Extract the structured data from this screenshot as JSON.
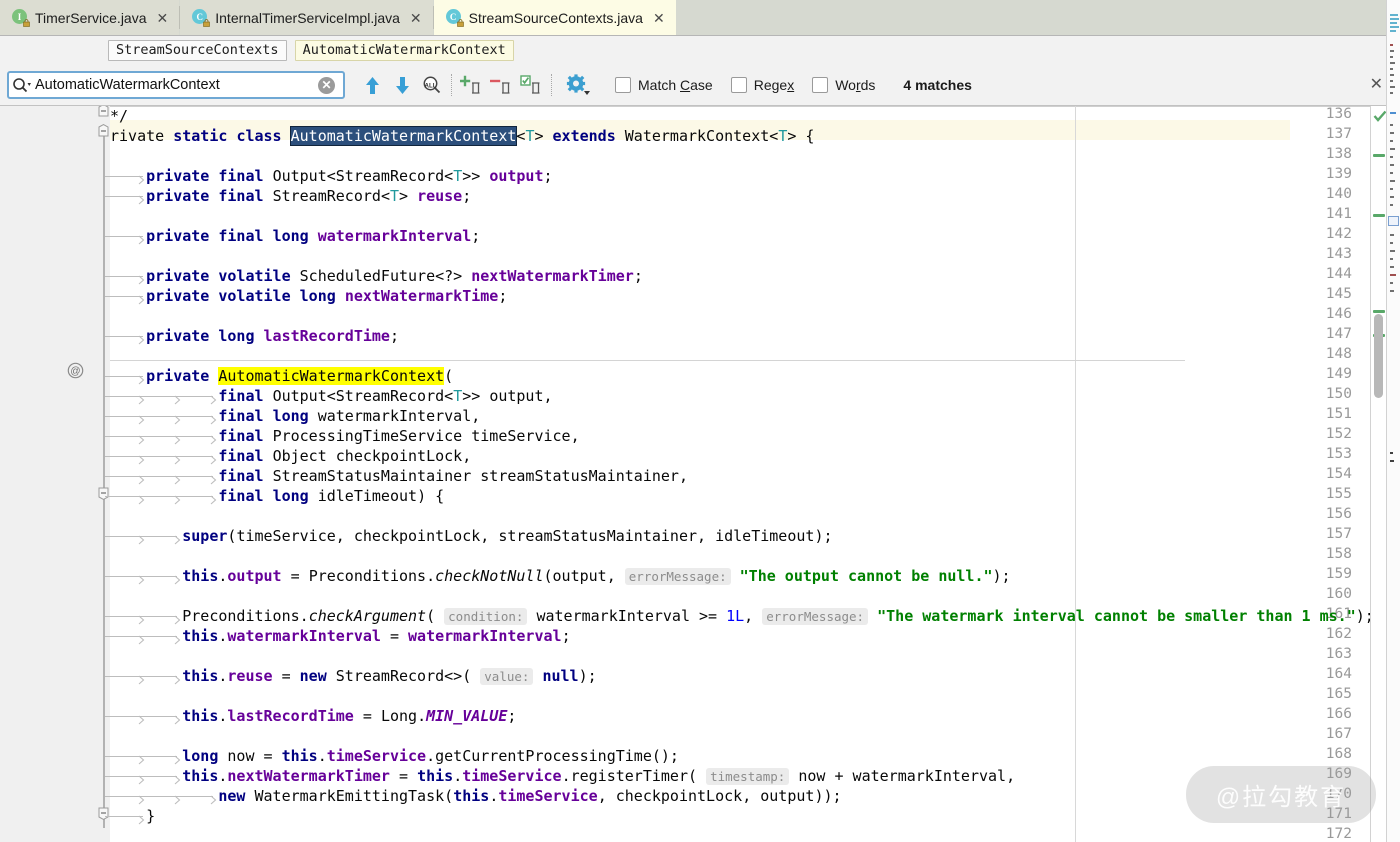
{
  "window": {
    "title": "StreamSourceContexts.java"
  },
  "tabs": [
    {
      "label": "TimerService.java",
      "icon": "interface-icon",
      "glyph": "I",
      "selected": false
    },
    {
      "label": "InternalTimerServiceImpl.java",
      "icon": "class-icon",
      "glyph": "C",
      "selected": false
    },
    {
      "label": "StreamSourceContexts.java",
      "icon": "class-icon",
      "glyph": "C",
      "selected": true
    }
  ],
  "tab_close_glyph": "✕",
  "breadcrumbs": [
    {
      "label": "StreamSourceContexts",
      "highlighted": false
    },
    {
      "label": "AutomaticWatermarkContext",
      "highlighted": true
    }
  ],
  "find": {
    "value": "AutomaticWatermarkContext",
    "placeholder": "Find",
    "clear_glyph": "✕",
    "buttons": [
      {
        "name": "find-previous-button",
        "tip": "Previous Occurrence"
      },
      {
        "name": "find-next-button",
        "tip": "Next Occurrence"
      },
      {
        "name": "select-all-occurrences-button",
        "tip": "Select All Occurrences"
      },
      {
        "name": "add-occurrence-button",
        "tip": "Add Occurrence"
      },
      {
        "name": "remove-occurrence-button",
        "tip": "Remove Occurrence"
      },
      {
        "name": "select-all-button",
        "tip": "Select All"
      },
      {
        "name": "find-settings-button",
        "tip": "Find Settings"
      }
    ],
    "options": [
      {
        "label_pre": "Match ",
        "label_mnemonic": "C",
        "label_post": "ase",
        "checked": false,
        "name": "match-case-checkbox"
      },
      {
        "label_pre": "Rege",
        "label_mnemonic": "x",
        "label_post": "",
        "checked": false,
        "name": "regex-checkbox"
      },
      {
        "label_pre": "Wo",
        "label_mnemonic": "r",
        "label_post": "ds",
        "checked": false,
        "name": "words-checkbox"
      }
    ],
    "status": "4 matches",
    "close_glyph": "✕"
  },
  "editor": {
    "first_line": 136,
    "last_line": 172,
    "annotation_line": 149,
    "annotation_glyph": "@",
    "caret_line": 137,
    "right_margin_col_x": 1075,
    "colors": {
      "keyword": "#000080",
      "field": "#660099",
      "string": "#008000",
      "number": "#0000ff",
      "generic": "#20999d",
      "hint_bg": "#ebebeb",
      "find_current": "#2c4f7c",
      "find_hit": "#ffff00",
      "caret_row": "#fcf9e7",
      "marker_green": "#59a869"
    },
    "lines": [
      {
        "n": 136,
        "text": "*/"
      },
      {
        "n": 137,
        "text": "rivate static class AutomaticWatermarkContext<T> extends WatermarkContext<T> {"
      },
      {
        "n": 138,
        "text": ""
      },
      {
        "n": 139,
        "text": "    private final Output<StreamRecord<T>> output;"
      },
      {
        "n": 140,
        "text": "    private final StreamRecord<T> reuse;"
      },
      {
        "n": 141,
        "text": ""
      },
      {
        "n": 142,
        "text": "    private final long watermarkInterval;"
      },
      {
        "n": 143,
        "text": ""
      },
      {
        "n": 144,
        "text": "    private volatile ScheduledFuture<?> nextWatermarkTimer;"
      },
      {
        "n": 145,
        "text": "    private volatile long nextWatermarkTime;"
      },
      {
        "n": 146,
        "text": ""
      },
      {
        "n": 147,
        "text": "    private long lastRecordTime;"
      },
      {
        "n": 148,
        "text": ""
      },
      {
        "n": 149,
        "text": "    private AutomaticWatermarkContext("
      },
      {
        "n": 150,
        "text": "            final Output<StreamRecord<T>> output,"
      },
      {
        "n": 151,
        "text": "            final long watermarkInterval,"
      },
      {
        "n": 152,
        "text": "            final ProcessingTimeService timeService,"
      },
      {
        "n": 153,
        "text": "            final Object checkpointLock,"
      },
      {
        "n": 154,
        "text": "            final StreamStatusMaintainer streamStatusMaintainer,"
      },
      {
        "n": 155,
        "text": "            final long idleTimeout) {"
      },
      {
        "n": 156,
        "text": ""
      },
      {
        "n": 157,
        "text": "        super(timeService, checkpointLock, streamStatusMaintainer, idleTimeout);"
      },
      {
        "n": 158,
        "text": ""
      },
      {
        "n": 159,
        "text": "        this.output = Preconditions.checkNotNull(output, errorMessage: \"The output cannot be null.\");"
      },
      {
        "n": 160,
        "text": ""
      },
      {
        "n": 161,
        "text": "        Preconditions.checkArgument( condition: watermarkInterval >= 1L, errorMessage: \"The watermark interval cannot be smaller than 1 ms.\");"
      },
      {
        "n": 162,
        "text": "        this.watermarkInterval = watermarkInterval;"
      },
      {
        "n": 163,
        "text": ""
      },
      {
        "n": 164,
        "text": "        this.reuse = new StreamRecord<>( value: null);"
      },
      {
        "n": 165,
        "text": ""
      },
      {
        "n": 166,
        "text": "        this.lastRecordTime = Long.MIN_VALUE;"
      },
      {
        "n": 167,
        "text": ""
      },
      {
        "n": 168,
        "text": "        long now = this.timeService.getCurrentProcessingTime();"
      },
      {
        "n": 169,
        "text": "        this.nextWatermarkTimer = this.timeService.registerTimer( timestamp: now + watermarkInterval,"
      },
      {
        "n": 170,
        "text": "            new WatermarkEmittingTask(this.timeService, checkpointLock, output));"
      },
      {
        "n": 171,
        "text": "    }"
      },
      {
        "n": 172,
        "text": ""
      }
    ],
    "inlay_hints": [
      {
        "line": 159,
        "label": "errorMessage:"
      },
      {
        "line": 161,
        "label": "condition:"
      },
      {
        "line": 161,
        "label": "errorMessage:"
      },
      {
        "line": 164,
        "label": "value:"
      },
      {
        "line": 169,
        "label": "timestamp:"
      }
    ]
  },
  "markers": {
    "status": "ok",
    "status_glyph": "✓",
    "green_marks_y": [
      150,
      210,
      306,
      330
    ]
  },
  "watermark": {
    "text": "@拉勾教育"
  }
}
